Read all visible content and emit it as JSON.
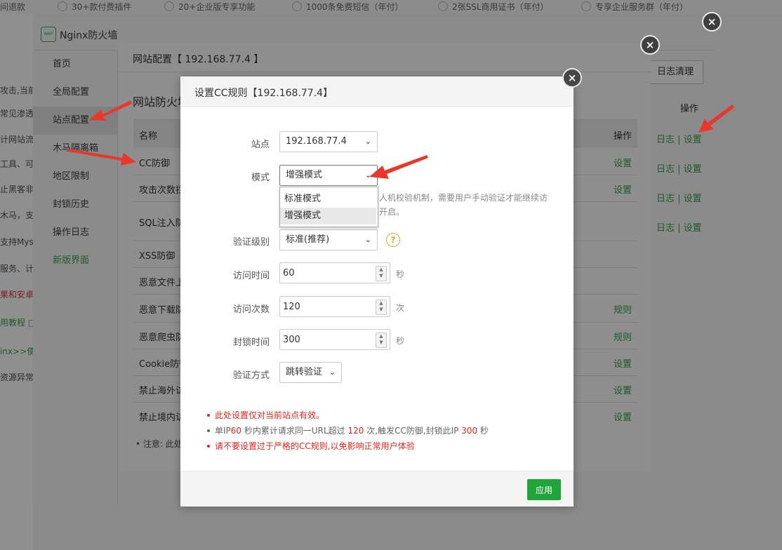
{
  "topbar": {
    "items": [
      "间退款",
      "30+款付费插件",
      "20+企业版专享功能",
      "1000条免费短信（年付）",
      "2张SSL商用证书（年付）",
      "专享企业服务群（年付）"
    ]
  },
  "background_page": {
    "fragments": [
      "攻击,当前",
      "常见渗透攻",
      "计网站流量",
      "工具、可",
      "止黑客非法",
      "木马，支持",
      "支持Mysq",
      "服务、计划",
      "果和安卓端",
      "用教程 ▢",
      "inx>>使",
      "资源异常并"
    ]
  },
  "firewall": {
    "title": "Nginx防火墙",
    "logo_text": "WAF",
    "nav": [
      "首页",
      "全局配置",
      "站点配置",
      "木马隔离箱",
      "地区限制",
      "封锁历史",
      "操作日志",
      "新版界面"
    ],
    "log_clean": "日志清理",
    "op_header": "操作",
    "row_actions": {
      "log": "日志",
      "sep": " | ",
      "set": "设置"
    }
  },
  "site_config": {
    "title": "网站配置【 192.168.77.4 】",
    "subtitle": "网站防火墙",
    "col_name": "名称",
    "col_op": "操作",
    "rows": [
      {
        "name": "CC防御",
        "op": "设置"
      },
      {
        "name": "攻击次数拦截",
        "op": "设置"
      },
      {
        "name": "SQL注入防御",
        "op": ""
      },
      {
        "name": "XSS防御",
        "op": ""
      },
      {
        "name": "恶意文件上传",
        "op": ""
      },
      {
        "name": "恶意下载防御",
        "op": "规则"
      },
      {
        "name": "恶意爬虫防御",
        "op": "规则"
      },
      {
        "name": "Cookie防御",
        "op": "设置"
      },
      {
        "name": "禁止海外访问",
        "op": "设置"
      },
      {
        "name": "禁止境内访问",
        "op": "设置"
      }
    ],
    "note": "• 注意: 此处"
  },
  "cc_modal": {
    "title": "设置CC规则【192.168.77.4】",
    "site_label": "站点",
    "site_value": "192.168.77.4",
    "mode_label": "模式",
    "mode_value": "增强模式",
    "mode_options": [
      "标准模式",
      "增强模式"
    ],
    "mode_desc_1": "人机校验机制，需要用户手动验证才能继续访",
    "mode_desc_2": "开启。",
    "level_label": "验证级别",
    "level_value": "标准(推荐)",
    "help_symbol": "?",
    "visit_time_label": "访问时间",
    "visit_time_value": "60",
    "visit_time_unit": "秒",
    "visit_count_label": "访问次数",
    "visit_count_value": "120",
    "visit_count_unit": "次",
    "block_time_label": "封锁时间",
    "block_time_value": "300",
    "block_time_unit": "秒",
    "verify_label": "验证方式",
    "verify_value": "跳转验证",
    "note_1": "此处设置仅对当前站点有效。",
    "note_2": {
      "p1": "单IP",
      "v1": "60",
      "p2": " 秒内累计请求同一URL超过 ",
      "v2": "120",
      "p3": " 次,触发CC防御,封锁此IP ",
      "v3": "300",
      "p4": " 秒"
    },
    "note_3": "请不要设置过于严格的CC规则,以免影响正常用户体验",
    "apply_label": "应用"
  },
  "close_icon": "×",
  "colors": {
    "accent_green": "#20a53a",
    "note_red": "#e0231c",
    "arrow_red": "#e8382c",
    "help_orange": "#e8a13a"
  }
}
